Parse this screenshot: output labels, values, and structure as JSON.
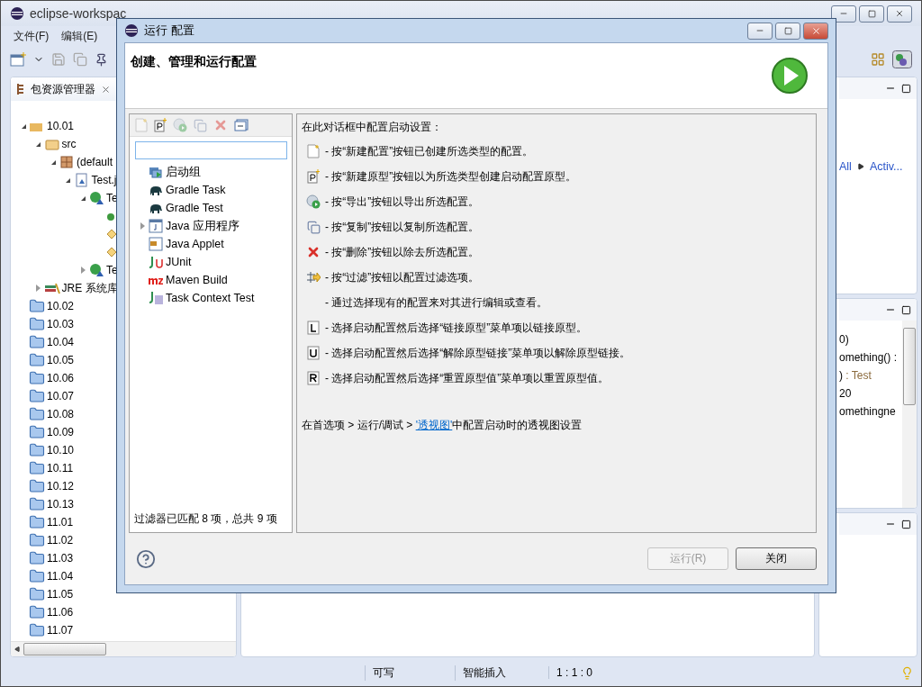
{
  "ide": {
    "title": "eclipse-workspac",
    "menu": [
      "文件(F)",
      "编辑(E)"
    ]
  },
  "explorer": {
    "tab": "包资源管理器",
    "tree": [
      {
        "kind": "project",
        "label": "10.01",
        "expanded": true,
        "children": [
          {
            "kind": "src-folder",
            "label": "src",
            "expanded": true,
            "children": [
              {
                "kind": "package",
                "label": "(default",
                "expanded": true,
                "children": [
                  {
                    "kind": "java-file",
                    "label": "Test.j",
                    "expanded": true,
                    "children": [
                      {
                        "kind": "class",
                        "label": "Te",
                        "expanded": true,
                        "children": [
                          {
                            "kind": "constructor"
                          },
                          {
                            "kind": "method"
                          },
                          {
                            "kind": "method"
                          }
                        ]
                      },
                      {
                        "kind": "class",
                        "label": "Te",
                        "expanded": false
                      }
                    ]
                  }
                ]
              }
            ]
          },
          {
            "kind": "library",
            "label": "JRE 系统库",
            "expanded": false
          }
        ]
      },
      {
        "kind": "folder",
        "label": "10.02"
      },
      {
        "kind": "folder",
        "label": "10.03"
      },
      {
        "kind": "folder",
        "label": "10.04"
      },
      {
        "kind": "folder",
        "label": "10.05"
      },
      {
        "kind": "folder",
        "label": "10.06"
      },
      {
        "kind": "folder",
        "label": "10.07"
      },
      {
        "kind": "folder",
        "label": "10.08"
      },
      {
        "kind": "folder",
        "label": "10.09"
      },
      {
        "kind": "folder",
        "label": "10.10"
      },
      {
        "kind": "folder",
        "label": "10.11"
      },
      {
        "kind": "folder",
        "label": "10.12"
      },
      {
        "kind": "folder",
        "label": "10.13"
      },
      {
        "kind": "folder",
        "label": "11.01"
      },
      {
        "kind": "folder",
        "label": "11.02"
      },
      {
        "kind": "folder",
        "label": "11.03"
      },
      {
        "kind": "folder",
        "label": "11.04"
      },
      {
        "kind": "folder",
        "label": "11.05"
      },
      {
        "kind": "folder",
        "label": "11.06"
      },
      {
        "kind": "folder",
        "label": "11.07"
      }
    ]
  },
  "right_view": {
    "links": [
      "All",
      "Activ..."
    ],
    "code_lines": [
      {
        "text": "0)"
      },
      {
        "text": "omething() :"
      },
      {
        "text": ")",
        "type": " : Test"
      },
      {
        "text": "20"
      },
      {
        "text": "omethingne"
      }
    ]
  },
  "status_bar": [
    "可写",
    "智能插入",
    "1 : 1 : 0"
  ],
  "dialog": {
    "title": "运行 配置",
    "header": "创建、管理和运行配置",
    "config_types": [
      {
        "kind": "launch-group",
        "label": "启动组"
      },
      {
        "kind": "gradle",
        "label": "Gradle Task"
      },
      {
        "kind": "gradle",
        "label": "Gradle Test"
      },
      {
        "kind": "java-app",
        "label": "Java 应用程序",
        "expanded": false
      },
      {
        "kind": "applet",
        "label": "Java Applet"
      },
      {
        "kind": "junit",
        "label": "JUnit"
      },
      {
        "kind": "maven",
        "label": "Maven Build"
      },
      {
        "kind": "task-test",
        "label": "Task Context Test"
      }
    ],
    "filter_status": "过滤器已匹配 8 项，总共 9 项",
    "intro": "在此对话框中配置启动设置：",
    "help_lines": [
      {
        "kind": "new",
        "text": "- 按“新建配置”按钮已创建所选类型的配置。"
      },
      {
        "kind": "prototype",
        "text": "- 按“新建原型”按钮以为所选类型创建启动配置原型。"
      },
      {
        "kind": "export",
        "text": "- 按“导出”按钮以导出所选配置。"
      },
      {
        "kind": "duplicate",
        "text": "- 按“复制”按钮以复制所选配置。"
      },
      {
        "kind": "delete",
        "text": "- 按“删除”按钮以除去所选配置。"
      },
      {
        "kind": "filter",
        "text": "- 按“过滤”按钮以配置过滤选项。"
      },
      {
        "kind": "none",
        "text": "- 通过选择现有的配置来对其进行编辑或查看。"
      },
      {
        "kind": "link",
        "text": "- 选择启动配置然后选择“链接原型”菜单项以链接原型。"
      },
      {
        "kind": "unlink",
        "text": "- 选择启动配置然后选择“解除原型链接”菜单项以解除原型链接。"
      },
      {
        "kind": "reset",
        "text": "- 选择启动配置然后选择“重置原型值”菜单项以重置原型值。"
      }
    ],
    "footer": {
      "before": "在首选项 > 运行/调试 > ",
      "link": "'透视图'",
      "after": "中配置启动时的透视图设置"
    },
    "buttons": [
      {
        "label": "运行(R)",
        "disabled": true
      },
      {
        "label": "关闭",
        "disabled": false
      }
    ]
  }
}
